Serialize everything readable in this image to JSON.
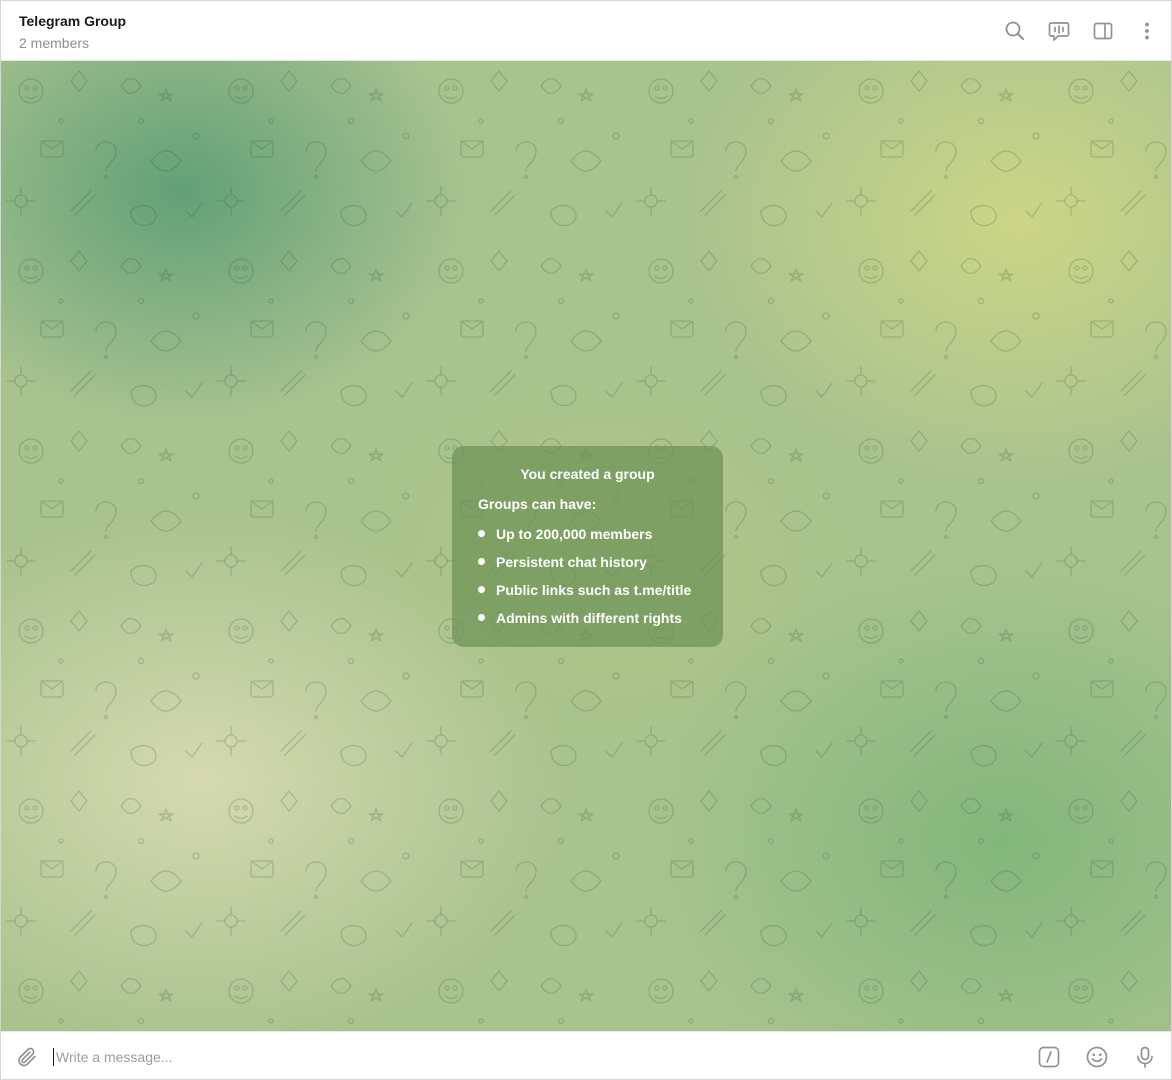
{
  "header": {
    "title": "Telegram Group",
    "subtitle": "2 members",
    "actions": [
      "search-icon",
      "voice-chat-icon",
      "sidebar-toggle-icon",
      "more-vertical-icon"
    ]
  },
  "service_message": {
    "title": "You created a group",
    "intro": "Groups can have:",
    "items": [
      "Up to 200,000 members",
      "Persistent chat history",
      "Public links such as t.me/title",
      "Admins with different rights"
    ]
  },
  "composer": {
    "placeholder": "Write a message...",
    "value": "",
    "left_icon": "paperclip-icon",
    "right_icons": [
      "bot-commands-icon",
      "emoji-icon",
      "microphone-icon"
    ]
  },
  "colors": {
    "icon": "#8e9398",
    "service_bg": "#6e9158"
  }
}
